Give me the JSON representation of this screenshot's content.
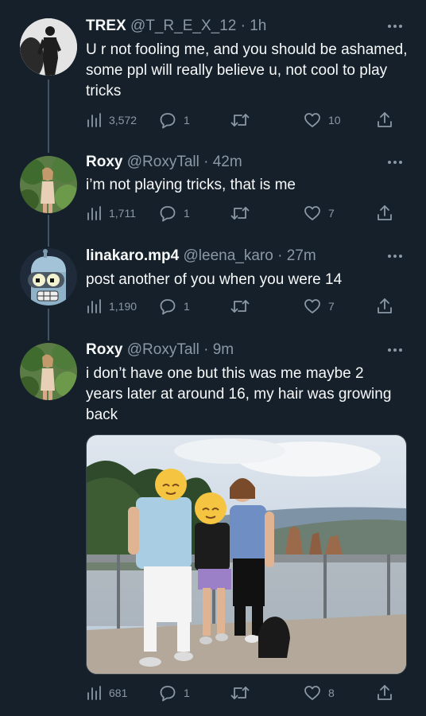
{
  "tweets": [
    {
      "name": "TREX",
      "meta": "@T_R_E_X_12 · 1h",
      "text": "U r not fooling me, and you should be ashamed, some ppl will really believe u, not cool to play tricks",
      "views": "3,572",
      "replies": "1",
      "retweets": "",
      "likes": "10"
    },
    {
      "name": "Roxy",
      "meta": "@RoxyTall · 42m",
      "text": "i’m not playing tricks, that is me",
      "views": "1,711",
      "replies": "1",
      "retweets": "",
      "likes": "7"
    },
    {
      "name": "linakaro.mp4",
      "meta": "@leena_karo · 27m",
      "text": "post another of you when you were 14",
      "views": "1,190",
      "replies": "1",
      "retweets": "",
      "likes": "7"
    },
    {
      "name": "Roxy",
      "meta": "@RoxyTall · 9m",
      "text": "i don’t have one but this was me maybe 2 years later at around 16, my hair was growing back",
      "views": "681",
      "replies": "1",
      "retweets": "",
      "likes": "8"
    }
  ],
  "icons": {
    "views": "analytics-icon",
    "reply": "reply-icon",
    "retweet": "retweet-icon",
    "like": "heart-icon",
    "share": "share-icon",
    "more": "more-icon"
  },
  "colors": {
    "background": "#15202b",
    "text": "#f7f9f9",
    "muted": "#8b98a5",
    "thread_line": "#425364"
  }
}
